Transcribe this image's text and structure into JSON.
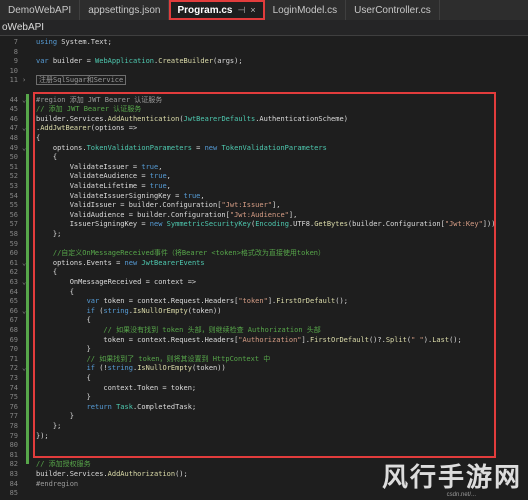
{
  "tabs": [
    {
      "label": "DemoWebAPI",
      "active": false
    },
    {
      "label": "appsettings.json",
      "active": false
    },
    {
      "label": "Program.cs",
      "active": true
    },
    {
      "label": "LoginModel.cs",
      "active": false
    },
    {
      "label": "UserController.cs",
      "active": false
    }
  ],
  "tab_pin_glyph": "⊣",
  "tab_close_glyph": "×",
  "project": "oWebAPI",
  "watermark": "风行手游网",
  "watermark_url": "csdn.net/...",
  "highlight_color": "#e23c3c",
  "line_numbers": [
    "7",
    "8",
    "9",
    "10",
    "11",
    "",
    "44",
    "45",
    "46",
    "47",
    "48",
    "49",
    "50",
    "51",
    "52",
    "53",
    "54",
    "55",
    "56",
    "57",
    "58",
    "59",
    "60",
    "61",
    "62",
    "63",
    "64",
    "65",
    "66",
    "67",
    "68",
    "69",
    "70",
    "71",
    "72",
    "73",
    "74",
    "75",
    "76",
    "77",
    "78",
    "79",
    "80",
    "81",
    "82",
    "83",
    "84",
    "85"
  ],
  "code_lines": [
    {
      "text": "using System.Text;"
    },
    {
      "text": ""
    },
    {
      "text": "var builder = WebApplication.CreateBuilder(args);"
    },
    {
      "text": ""
    },
    {
      "text": "注册SqlSugar和Service",
      "collapsed": true
    },
    {
      "text": ""
    },
    {
      "text": "#region 添加 JWT Bearer 认证服务"
    },
    {
      "text": "// 添加 JWT Bearer 认证服务"
    },
    {
      "text": "builder.Services.AddAuthentication(JwtBearerDefaults.AuthenticationScheme)"
    },
    {
      "text": ".AddJwtBearer(options =>"
    },
    {
      "text": "{"
    },
    {
      "text": "    options.TokenValidationParameters = new TokenValidationParameters"
    },
    {
      "text": "    {"
    },
    {
      "text": "        ValidateIssuer = true,"
    },
    {
      "text": "        ValidateAudience = true,"
    },
    {
      "text": "        ValidateLifetime = true,"
    },
    {
      "text": "        ValidateIssuerSigningKey = true,"
    },
    {
      "text": "        ValidIssuer = builder.Configuration[\"Jwt:Issuer\"],"
    },
    {
      "text": "        ValidAudience = builder.Configuration[\"Jwt:Audience\"],"
    },
    {
      "text": "        IssuerSigningKey = new SymmetricSecurityKey(Encoding.UTF8.GetBytes(builder.Configuration[\"Jwt:Key\"]))"
    },
    {
      "text": "    };"
    },
    {
      "text": ""
    },
    {
      "text": "    //自定义OnMessageReceived事件（将Bearer <token>格式改为直接使用token）"
    },
    {
      "text": "    options.Events = new JwtBearerEvents"
    },
    {
      "text": "    {"
    },
    {
      "text": "        OnMessageReceived = context =>"
    },
    {
      "text": "        {"
    },
    {
      "text": "            var token = context.Request.Headers[\"token\"].FirstOrDefault();"
    },
    {
      "text": "            if (string.IsNullOrEmpty(token))"
    },
    {
      "text": "            {"
    },
    {
      "text": "                // 如果没有找到 token 头部，则继续检查 Authorization 头部"
    },
    {
      "text": "                token = context.Request.Headers[\"Authorization\"].FirstOrDefault()?.Split(\" \").Last();"
    },
    {
      "text": "            }"
    },
    {
      "text": "            // 如果找到了 token，则将其设置到 HttpContext 中"
    },
    {
      "text": "            if (!string.IsNullOrEmpty(token))"
    },
    {
      "text": "            {"
    },
    {
      "text": "                context.Token = token;"
    },
    {
      "text": "            }"
    },
    {
      "text": "            return Task.CompletedTask;"
    },
    {
      "text": "        }"
    },
    {
      "text": "    };"
    },
    {
      "text": "});"
    },
    {
      "text": ""
    },
    {
      "text": ""
    },
    {
      "text": "// 添加授权服务"
    },
    {
      "text": "builder.Services.AddAuthorization();"
    },
    {
      "text": "#endregion"
    },
    {
      "text": ""
    }
  ]
}
